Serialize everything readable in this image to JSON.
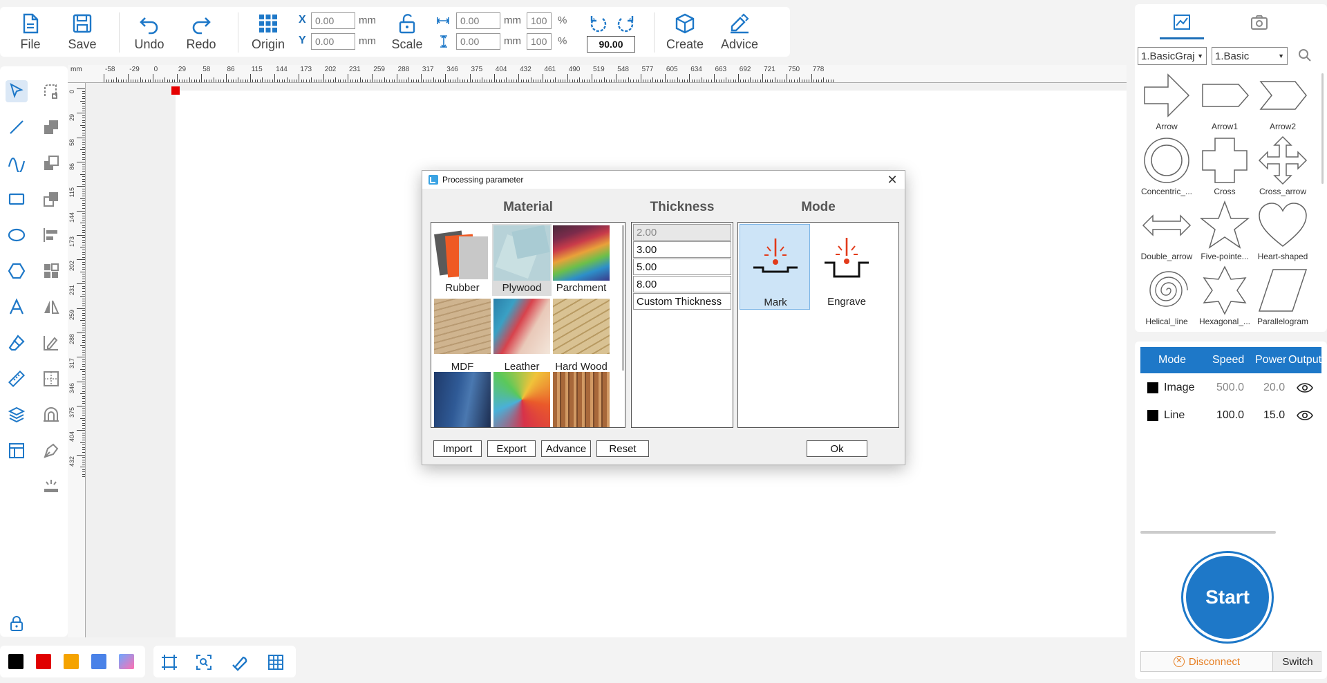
{
  "toolbar": {
    "file": "File",
    "save": "Save",
    "undo": "Undo",
    "redo": "Redo",
    "origin": "Origin",
    "scale": "Scale",
    "create": "Create",
    "advice": "Advice",
    "x_label": "X",
    "y_label": "Y",
    "x_value": "0.00",
    "y_value": "0.00",
    "unit_mm": "mm",
    "width_value": "0.00",
    "height_value": "0.00",
    "width_pct": "100",
    "height_pct": "100",
    "pct_unit": "%",
    "rotation": "90.00"
  },
  "ruler": {
    "unit": "mm",
    "top_ticks": [
      "-58",
      "-29",
      "0",
      "29",
      "58",
      "86",
      "115",
      "144",
      "173",
      "202",
      "231",
      "259",
      "288",
      "317",
      "346",
      "375",
      "404",
      "432",
      "461",
      "490",
      "519",
      "548",
      "577",
      "605",
      "634",
      "663",
      "692",
      "721",
      "750",
      "778"
    ],
    "left_ticks": [
      "0",
      "29",
      "58",
      "86",
      "115",
      "144",
      "173",
      "202",
      "231",
      "259",
      "288",
      "317",
      "346",
      "375",
      "404",
      "432"
    ]
  },
  "colors": {
    "accent": "#1e78c8",
    "swatches": [
      "#000000",
      "#e00000",
      "#f5a300",
      "#4a82e8",
      "#d36fd0"
    ]
  },
  "shapes_panel": {
    "category": "1.BasicGraj",
    "subcategory": "1.Basic",
    "shapes": [
      "Arrow",
      "Arrow1",
      "Arrow2",
      "Concentric_...",
      "Cross",
      "Cross_arrow",
      "Double_arrow",
      "Five-pointe...",
      "Heart-shaped",
      "Helical_line",
      "Hexagonal_...",
      "Parallelogram"
    ]
  },
  "layers": {
    "headers": {
      "mode": "Mode",
      "speed": "Speed",
      "power": "Power",
      "output": "Output"
    },
    "rows": [
      {
        "mode": "Image",
        "speed": "500.0",
        "power": "20.0",
        "color": "#000000"
      },
      {
        "mode": "Line",
        "speed": "100.0",
        "power": "15.0",
        "color": "#000000"
      }
    ]
  },
  "start_label": "Start",
  "disconnect_label": "Disconnect",
  "switch_label": "Switch",
  "dialog": {
    "title": "Processing parameter",
    "material_heading": "Material",
    "thickness_heading": "Thickness",
    "mode_heading": "Mode",
    "materials": [
      "Rubber",
      "Plywood",
      "Parchment",
      "MDF",
      "Leather",
      "Hard Wood",
      "",
      "",
      ""
    ],
    "selected_material": "Plywood",
    "thicknesses": [
      "2.00",
      "3.00",
      "5.00",
      "8.00",
      "Custom Thickness"
    ],
    "modes": [
      "Mark",
      "Engrave"
    ],
    "selected_mode": "Mark",
    "buttons": {
      "import": "Import",
      "export": "Export",
      "advance": "Advance",
      "reset": "Reset",
      "ok": "Ok"
    }
  }
}
